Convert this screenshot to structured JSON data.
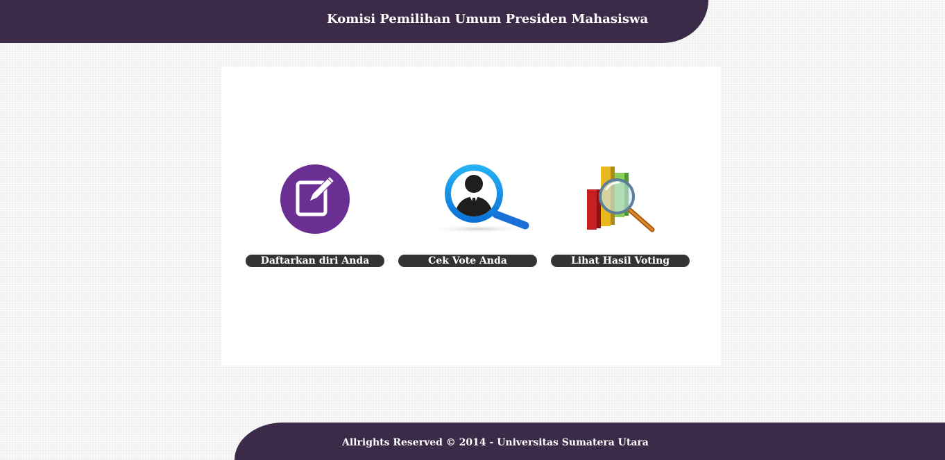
{
  "header": {
    "title": "Komisi Pemilihan Umum Presiden Mahasiswa"
  },
  "menu": [
    {
      "label": "Daftarkan diri Anda",
      "icon": "register-edit-icon"
    },
    {
      "label": "Cek Vote Anda",
      "icon": "person-search-icon"
    },
    {
      "label": "Lihat Hasil Voting",
      "icon": "chart-magnifier-icon"
    }
  ],
  "footer": {
    "text": "Allrights Reserved © 2014 - Universitas Sumatera Utara"
  },
  "colors": {
    "header_bg": "#3b2a48",
    "footer_bg": "#3b2a48",
    "button_bg": "#333333",
    "register_icon": "#6b2f94",
    "search_icon": "#1a8fe8"
  }
}
